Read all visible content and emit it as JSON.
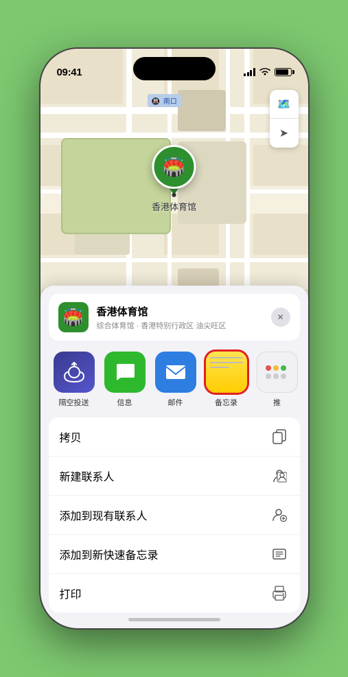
{
  "status_bar": {
    "time": "09:41",
    "location_arrow": "▶"
  },
  "map": {
    "road_label": "南口"
  },
  "location_pin": {
    "label": "香港体育馆"
  },
  "location_card": {
    "name": "香港体育馆",
    "subtitle": "综合体育馆 · 香港特别行政区 油尖旺区",
    "close_icon": "✕"
  },
  "share_apps": [
    {
      "id": "airdrop",
      "name": "隔空投送",
      "icon": "📡"
    },
    {
      "id": "messages",
      "name": "信息",
      "icon": "💬"
    },
    {
      "id": "mail",
      "name": "邮件",
      "icon": "✉"
    },
    {
      "id": "notes",
      "name": "备忘录",
      "icon": "notes",
      "highlighted": true
    },
    {
      "id": "more",
      "name": "推",
      "icon": "···"
    }
  ],
  "actions": [
    {
      "id": "copy",
      "label": "拷贝",
      "icon": "copy"
    },
    {
      "id": "new-contact",
      "label": "新建联系人",
      "icon": "person"
    },
    {
      "id": "add-existing",
      "label": "添加到现有联系人",
      "icon": "person-plus"
    },
    {
      "id": "quick-note",
      "label": "添加到新快速备忘录",
      "icon": "quick-note"
    },
    {
      "id": "print",
      "label": "打印",
      "icon": "print"
    }
  ],
  "home_indicator": true
}
